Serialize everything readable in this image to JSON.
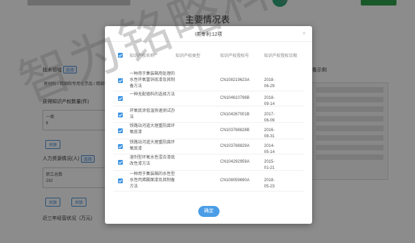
{
  "page": {
    "title": "主要情况表"
  },
  "form": {
    "tech_field_label": "技术领域",
    "tech_field_btn": "选择",
    "tech_field_value": "新材料 / 精细和专用化学品 / 精细化工",
    "ip_label": "获得知识产权数量(件)",
    "ip_class": "一类",
    "ip_class_value": "6",
    "link_btn": "关联",
    "hr_label": "人力资源情况(人)",
    "hr_sub": "职工总数",
    "hr_value": "292",
    "finance_label": "近三年经营状况（万元）",
    "sample_label": "看示例"
  },
  "modal": {
    "title": "I类专利:12项",
    "close_glyph": "×",
    "columns": [
      "知识产权名称",
      "知识产权类型",
      "知识产权授权号",
      "知识产权授权日期"
    ],
    "rows": [
      {
        "name": "一种用于集装箱用处理的水性环氧富锌底漆及其制备方法",
        "type": "",
        "number": "CN108219623A",
        "date": "2018-06-29"
      },
      {
        "name": "一种无配填料的选择方法",
        "type": "",
        "number": "CN104610796B",
        "date": "2018-09-14"
      },
      {
        "name": "环氧底涂低温快速测试办法",
        "type": "",
        "number": "CN104267001B",
        "date": "2017-06-09"
      },
      {
        "name": "铁路站河道大理重防腐环氧底漆",
        "type": "",
        "number": "CN103788828B",
        "date": "2016-08-31"
      },
      {
        "name": "铁路站河道大理重防腐环氧底漆",
        "type": "",
        "number": "CN103788829A",
        "date": "2014-05-14"
      },
      {
        "name": "溶剂型环氧水性混合漆底改性漆方法",
        "type": "",
        "number": "CN104292959A",
        "date": "2015-01-21"
      },
      {
        "name": "一种用于集装箱的水性型水性丙烯酸面漆及其制备方法",
        "type": "",
        "number": "CN108059690A",
        "date": "2018-05-23"
      }
    ],
    "confirm_label": "确定"
  },
  "watermark": "智为铭略科技咨询",
  "colors": {
    "accent": "#3b93e4",
    "confirm": "#4a9de6",
    "overlay": "rgba(0,0,0,0.45)"
  }
}
